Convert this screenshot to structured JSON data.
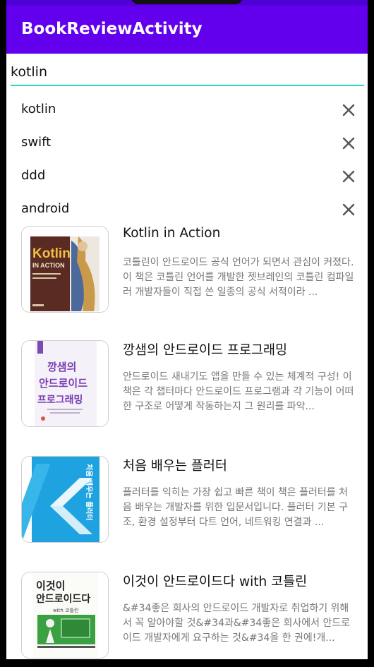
{
  "app": {
    "title": "BookReviewActivity"
  },
  "search": {
    "value": "kotlin"
  },
  "history": [
    {
      "keyword": "kotlin"
    },
    {
      "keyword": "swift"
    },
    {
      "keyword": "ddd"
    },
    {
      "keyword": "android"
    }
  ],
  "books": [
    {
      "title": "Kotlin in Action",
      "description": "코틀린이 안드로이드 공식 언어가 되면서 관심이 커졌다. 이 책은 코틀린 언어를 개발한 젯브레인의 코틀린 컴파일러 개발자들이 직접 쓴 일종의 공식 서적이라 ...",
      "cover_text": [
        "Kotlin",
        "IN ACTION"
      ]
    },
    {
      "title": "깡샘의 안드로이드 프로그래밍",
      "description": "안드로이드 새내기도 앱을 만들 수 있는 체계적 구성! 이 책은 각 챕터마다 안드로이드 프로그램과 각 기능이 어떠한 구조로 어떻게 작동하는지 그 원리를 파악...",
      "cover_text": [
        "깡샘의",
        "안드로이드",
        "프로그래밍"
      ]
    },
    {
      "title": "처음 배우는 플러터",
      "description": "플러터를 익히는 가장 쉽고 빠른 책이 책은 플러터를 처음 배우는 개발자를 위한 입문서입니다. 플러터 기본 구조, 환경 설정부터 다트 언어, 네트워킹 연결과 ...",
      "cover_text": [
        "처음 배우는 플러터"
      ]
    },
    {
      "title": "이것이 안드로이드다 with 코틀린",
      "description": "&#34좋은 회사의 안드로이드 개발자로 취업하기 위해서 꼭 알아야할 것&#34과&#34좋은 회사에서 안드로이드 개발자에게 요구하는 것&#34을 한 권에!개...",
      "cover_text": [
        "이것이",
        "안드로이드다",
        "with 코틀린"
      ]
    }
  ],
  "colors": {
    "appbar": "#6200ee",
    "status": "#4f00d6",
    "accent": "#2dd4c4"
  },
  "icons": {
    "delete": "close-icon"
  }
}
